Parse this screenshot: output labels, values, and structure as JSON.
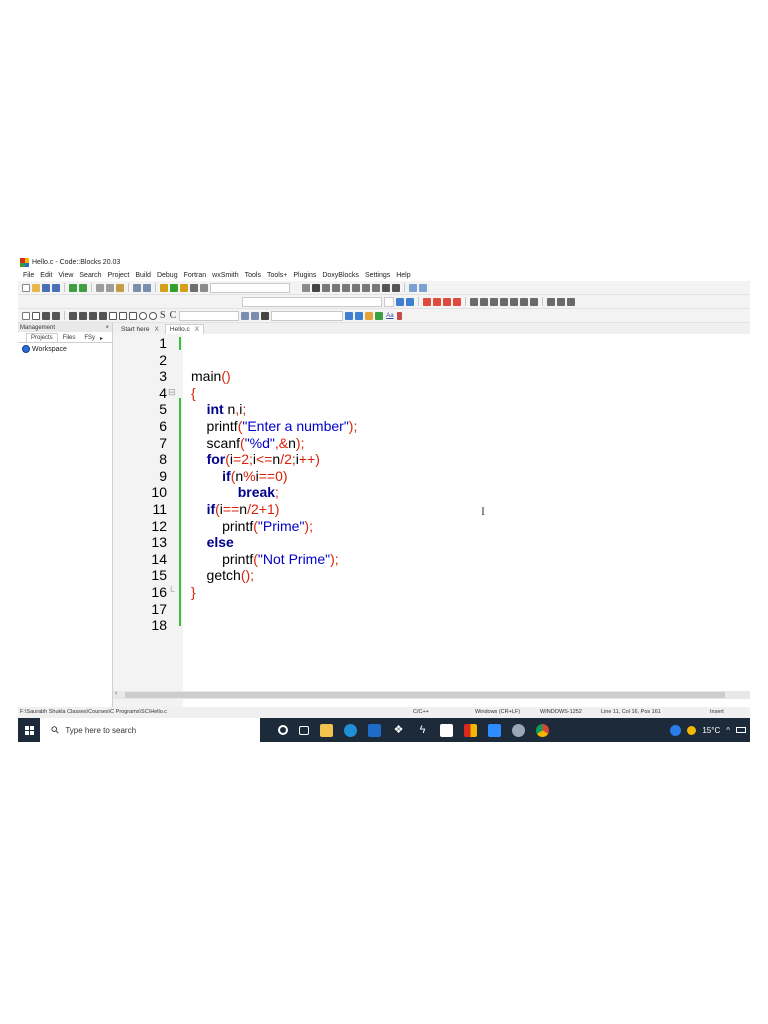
{
  "window": {
    "title": "Hello.c - Code::Blocks 20.03"
  },
  "menu": [
    "File",
    "Edit",
    "View",
    "Search",
    "Project",
    "Build",
    "Debug",
    "Fortran",
    "wxSmith",
    "Tools",
    "Tools+",
    "Plugins",
    "DoxyBlocks",
    "Settings",
    "Help"
  ],
  "toolbar": {
    "text_s": "S",
    "text_c": "C",
    "aa_label": "Aa"
  },
  "management": {
    "title": "Management",
    "close": "×",
    "tabs": [
      "Projects",
      "Files",
      "FSy"
    ],
    "tab_more": "▸",
    "workspace": "Workspace"
  },
  "editor": {
    "tabs": [
      {
        "label": "Start here",
        "close": "X"
      },
      {
        "label": "Hello.c",
        "close": "X"
      }
    ],
    "line_numbers": [
      "1",
      "2",
      "3",
      "4",
      "5",
      "6",
      "7",
      "8",
      "9",
      "10",
      "11",
      "12",
      "13",
      "14",
      "15",
      "16",
      "17",
      "18"
    ],
    "code": [
      "",
      "",
      "main()",
      "{",
      "    int n,i;",
      "    printf(\"Enter a number\");",
      "    scanf(\"%d\",&n);",
      "    for(i=2;i<=n/2;i++)",
      "        if(n%i==0)",
      "            break;",
      "    if(i==n/2+1)",
      "        printf(\"Prime\");",
      "    else",
      "        printf(\"Not Prime\");",
      "    getch();",
      "}",
      "",
      ""
    ],
    "cursor_glyph": "I"
  },
  "status": {
    "path": "F:\\Saurabh Shukla Classes\\Courses\\C Programs\\SC\\Hello.c",
    "language": "C/C++",
    "line_ending": "Windows (CR+LF)",
    "encoding": "WINDOWS-1252",
    "position": "Line 11, Col 16, Pos 161",
    "mode": "Insert"
  },
  "taskbar": {
    "search_placeholder": "Type here to search",
    "temperature": "15°C",
    "tray_arrow": "^"
  }
}
